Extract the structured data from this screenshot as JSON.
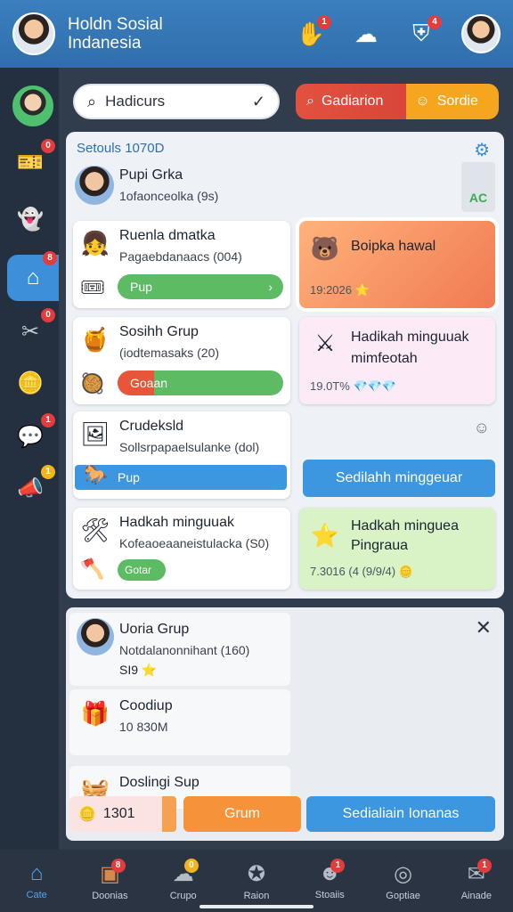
{
  "header": {
    "title_line1": "Holdn Sosial",
    "title_line2": "Indanesia",
    "icons": [
      {
        "name": "hand-icon",
        "badge": "1"
      },
      {
        "name": "chat-bubble-icon",
        "badge": ""
      },
      {
        "name": "shield-icon",
        "badge": "4"
      }
    ]
  },
  "sidebar": {
    "items": [
      {
        "icon": "ticket-icon",
        "badge": "0"
      },
      {
        "icon": "ghost-icon",
        "badge": ""
      },
      {
        "icon": "home-icon",
        "badge": "8"
      },
      {
        "icon": "tools-icon",
        "badge": "0"
      },
      {
        "icon": "coins-icon",
        "badge": ""
      },
      {
        "icon": "chat-icon",
        "badge": "1"
      },
      {
        "icon": "megaphone-icon",
        "badge": "1"
      }
    ]
  },
  "search": {
    "value": "Hadicurs"
  },
  "segments": {
    "left": "Gadiarion",
    "right": "Sordie"
  },
  "panel": {
    "title": "Setouls 1070D",
    "group": {
      "name": "Pupi Grka",
      "sub": "1ofaonceolka (9s)",
      "side_label": "AC"
    },
    "left_cards": [
      {
        "title": "Ruenla dmatka",
        "sub": "Pagaebdanaacs (004)",
        "bar": "Pup"
      },
      {
        "title": "Sosihh Grup",
        "sub": "(iodtemasaks (20)",
        "bar": "Goaan"
      },
      {
        "title": "Crudeksld",
        "sub": "Sollsrpapaelsulanke (dol)",
        "bar": "Pup"
      },
      {
        "title": "Hadkah minguuak",
        "sub": "Kofeaoeaaneistulacka (S0)",
        "bar": "Gotar"
      }
    ],
    "right_cards": [
      {
        "title": "Boipka hawal",
        "meta": "19:2026"
      },
      {
        "title": "Hadikah minguuak",
        "sub": "mimfeotah",
        "meta": "19.0T%"
      },
      {
        "button": "Sedilahh minggeuar"
      },
      {
        "title": "Hadkah minguea",
        "sub": "Pingraua",
        "meta": "7.3016 (4 (9/9/4)"
      }
    ]
  },
  "lower": {
    "items": [
      {
        "title": "Uoria Grup",
        "sub": "Notdalanonnihant (160)",
        "meta": "SI9"
      },
      {
        "title": "Coodiup",
        "sub": "10 830M"
      },
      {
        "title": "Doslingi Sup"
      }
    ],
    "footer": {
      "count": "1301",
      "orange": "Grum",
      "blue": "Sedialiain Ionanas"
    }
  },
  "bottom_nav": [
    {
      "label": "Cate",
      "icon": "home-icon",
      "badge": ""
    },
    {
      "label": "Doonias",
      "icon": "box-icon",
      "badge": "8"
    },
    {
      "label": "Crupo",
      "icon": "cloud-icon",
      "badge": "0"
    },
    {
      "label": "Raion",
      "icon": "gamepad-icon",
      "badge": ""
    },
    {
      "label": "Stoaiis",
      "icon": "friends-icon",
      "badge": "1"
    },
    {
      "label": "Goptiae",
      "icon": "headset-icon",
      "badge": ""
    },
    {
      "label": "Ainade",
      "icon": "mail-icon",
      "badge": "1"
    }
  ],
  "colors": {
    "accent": "#3d8fd9",
    "green": "#5dbb63",
    "orange": "#f6a51f",
    "red": "#e25140"
  }
}
